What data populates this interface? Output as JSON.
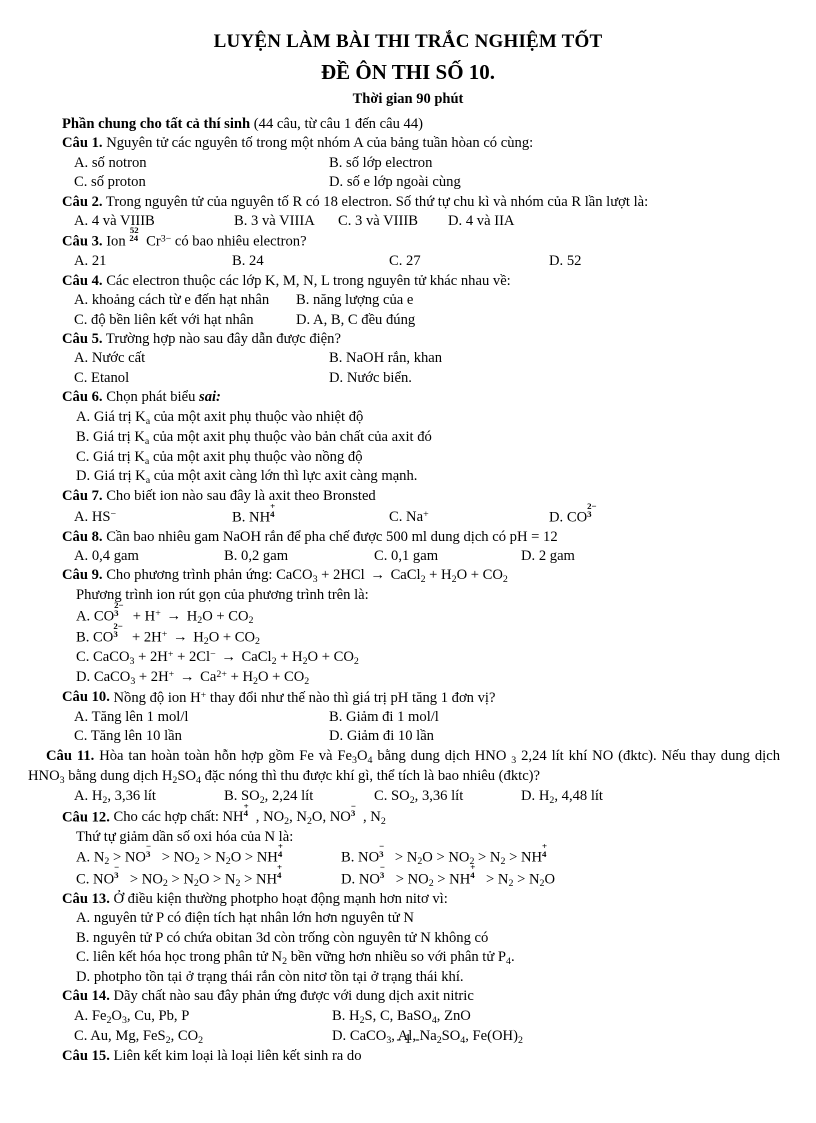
{
  "header": {
    "title_main": "LUYỆN LÀM BÀI THI TRẮC NGHIỆM TỐT",
    "title_sub": "ĐỀ ÔN THI SỐ 10.",
    "time_limit": "Thời gian 90 phút"
  },
  "section": {
    "label": "Phần chung cho tất cả thí sinh",
    "note": " (44 câu, từ câu 1 đến câu 44)"
  },
  "questions": [
    {
      "num": "Câu 1.",
      "text": " Nguyên tử các nguyên tố trong một nhóm A của bảng tuần hòan có cùng:",
      "options": [
        "A. số notron",
        "B. số lớp electron",
        "C. số proton",
        "D. số e lớp ngoài cùng"
      ]
    },
    {
      "num": "Câu 2.",
      "text": " Trong nguyên tử của nguyên tố R có 18 electron.  Số thứ tự chu kì và nhóm của R lần lượt là:",
      "options": [
        "A. 4 và VIIIB",
        "B. 3 và VIIIA",
        "C. 3 và VIIIB",
        "D. 4 và IIA"
      ]
    },
    {
      "num": "Câu 3.",
      "text_pre": " Ion ",
      "iso_up": "52",
      "iso_dn": "24",
      "elem": "Cr",
      "elem_charge": "3−",
      "text_post": " có bao nhiêu electron?",
      "options": [
        "A. 21",
        "B. 24",
        "C. 27",
        "D. 52"
      ]
    },
    {
      "num": "Câu 4.",
      "text": " Các electron thuộc các lớp K, M, N, L trong nguyên tử khác nhau về:",
      "options": [
        "A. khoảng cách từ e đến hạt nhân",
        "B. năng lượng của e",
        "C. độ bền liên kết với hạt nhân",
        "D. A, B, C đều đúng"
      ]
    },
    {
      "num": "Câu 5.",
      "text": " Trường hợp nào sau đây dẫn được điện?",
      "options": [
        "A. Nước cất",
        "B. NaOH rắn, khan",
        "C. Etanol",
        "D. Nước biển."
      ]
    },
    {
      "num": "Câu 6.",
      "text": " Chọn phát biểu ",
      "text_italic": "sai:",
      "options_html": [
        "A. Giá trị K<sub>a</sub> của một axit phụ thuộc vào nhiệt độ",
        "B. Giá trị K<sub>a</sub> của một axit phụ thuộc vào bản chất của axit đó",
        "C. Giá trị K<sub>a</sub> của một axit phụ thuộc vào nồng độ",
        "D. Giá trị K<sub>a</sub> của một axit càng lớn thì lực axit càng mạnh."
      ]
    },
    {
      "num": "Câu 7.",
      "text": " Cho biết ion nào sau đây là axit theo Bronsted",
      "options_plain": [
        "A. HS⁻",
        "B. NH₄⁺",
        "C. Na⁺",
        "D. CO₃²⁻"
      ]
    },
    {
      "num": "Câu 8.",
      "text": " Cần bao nhiêu gam NaOH rắn để pha chế được 500 ml dung dịch có pH = 12",
      "options": [
        "A. 0,4 gam",
        "B. 0,2 gam",
        "C. 0,1 gam",
        "D. 2 gam"
      ]
    },
    {
      "num": "Câu 9.",
      "text": " Cho phương trình phản ứng: CaCO₃ + 2HCl → CaCl₂ + H₂O + CO₂",
      "subtext": "Phương trình ion rút gọn của phương trình trên là:",
      "options_plain": [
        "A. CO₃²⁻ + H⁺ → H₂O + CO₂",
        "B. CO₃²⁻ + 2H⁺ → H₂O + CO₂",
        "C. CaCO₃ + 2H⁺ + 2Cl⁻ → CaCl₂ + H₂O + CO₂",
        "D. CaCO₃ + 2H⁺ → Ca²⁺ + H₂O + CO₂"
      ]
    },
    {
      "num": "Câu 10.",
      "text": " Nồng độ ion H⁺ thay đổi như thế nào thì giá trị pH tăng 1 đơn vị?",
      "options": [
        "A. Tăng lên 1 mol/l",
        "B. Giảm đi 1 mol/l",
        "C. Tăng lên 10 lần",
        "D. Giảm đi 10 lần"
      ]
    },
    {
      "num": "Câu 11.",
      "text": " Hòa tan hoàn toàn hỗn hợp gồm Fe và Fe₃O₄ bằng dung dịch HNO ₃ 2,24 lít khí NO (đktc). Nếu thay dung dịch HNO₃ bằng dung dịch H₂SO₄ đặc nóng thì thu được khí gì, thể tích là bao nhiêu (đktc)?",
      "options": [
        "A. H₂, 3,36 lít",
        "B. SO₂, 2,24 lít",
        "C. SO₂, 3,36 lít",
        "D. H₂, 4,48 lít"
      ]
    },
    {
      "num": "Câu 12.",
      "text": " Cho các hợp chất: NH₄⁺, NO₂, N₂O, NO₃⁻, N₂",
      "subtext": "Thứ tự giảm dần số oxi hóa của N là:",
      "options_plain": [
        "A. N₂ > NO₃⁻ > NO₂ > N₂O > NH₄⁺",
        "B. NO₃⁻ > N₂O > NO₂ > N₂ > NH₄⁺",
        "C. NO₃⁻ > NO₂ > N₂O > N₂ > NH₄⁺",
        "D. NO₃⁻ > NO₂ > NH₄⁺ > N₂ > N₂O"
      ]
    },
    {
      "num": "Câu 13.",
      "text": " Ở điều kiện thường photpho hoạt động mạnh hơn nitơ vì:",
      "options_plain": [
        "A. nguyên tử P có điện tích hạt nhân lớn hơn nguyên tử N",
        "B. nguyên tử P có chứa obitan 3d còn trống còn nguyên tử N không có",
        "C. liên kết hóa học trong phân tử N₂ bền vững hơn nhiều so với phân tử P₄.",
        "D. photpho tồn tại ở trạng thái rắn còn nitơ tồn tại ở trạng thái khí."
      ]
    },
    {
      "num": "Câu 14.",
      "text": " Dãy chất nào sau đây phản ứng được với dung dịch axit nitric",
      "options_plain": [
        "A. Fe₂O₃, Cu, Pb, P",
        "B. H₂S, C, BaSO₄, ZnO",
        "C. Au, Mg, FeS₂, CO₂",
        "D. CaCO₃, Al, Na₂SO₄, Fe(OH)₂"
      ]
    },
    {
      "num": "Câu 15.",
      "text": " Liên kết kim loại là loại liên kết sinh ra do",
      "options": []
    }
  ],
  "footer": {
    "page_number": "- 1 -"
  }
}
